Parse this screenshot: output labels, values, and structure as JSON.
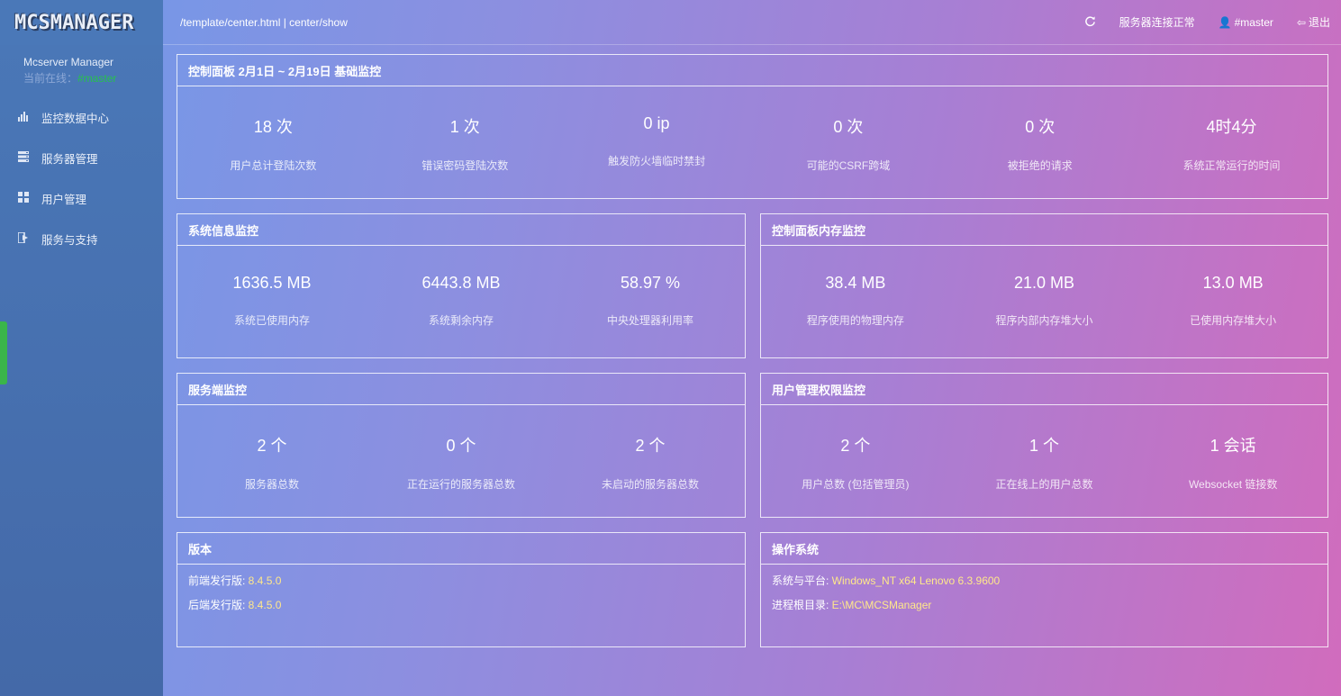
{
  "sidebar": {
    "logo": "MCSMANAGER",
    "app_name": "Mcserver Manager",
    "online_prefix": "当前在线：",
    "online_user": "#master",
    "items": [
      {
        "icon": "bar-chart-icon",
        "label": "监控数据中心"
      },
      {
        "icon": "server-icon",
        "label": "服务器管理"
      },
      {
        "icon": "grid-icon",
        "label": "用户管理"
      },
      {
        "icon": "support-icon",
        "label": "服务与支持"
      }
    ]
  },
  "topbar": {
    "path": "/template/center.html | center/show",
    "refresh_icon": "refresh-icon",
    "status": "服务器连接正常",
    "user": "#master",
    "logout": "退出"
  },
  "panels": {
    "overview": {
      "title": "控制面板 2月1日 ~ 2月19日 基础监控",
      "stats": [
        {
          "value": "18 次",
          "label": "用户总计登陆次数"
        },
        {
          "value": "1 次",
          "label": "错误密码登陆次数"
        },
        {
          "value": "0 ip",
          "label": "触发防火墙临时禁封"
        },
        {
          "value": "0 次",
          "label": "可能的CSRF跨域"
        },
        {
          "value": "0 次",
          "label": "被拒绝的请求"
        },
        {
          "value": "4时4分",
          "label": "系统正常运行的时间"
        }
      ]
    },
    "system": {
      "title": "系统信息监控",
      "stats": [
        {
          "value": "1636.5 MB",
          "label": "系统已使用内存"
        },
        {
          "value": "6443.8 MB",
          "label": "系统剩余内存"
        },
        {
          "value": "58.97 %",
          "label": "中央处理器利用率"
        }
      ]
    },
    "memory": {
      "title": "控制面板内存监控",
      "stats": [
        {
          "value": "38.4 MB",
          "label": "程序使用的物理内存"
        },
        {
          "value": "21.0 MB",
          "label": "程序内部内存堆大小"
        },
        {
          "value": "13.0 MB",
          "label": "已使用内存堆大小"
        }
      ]
    },
    "servers": {
      "title": "服务端监控",
      "stats": [
        {
          "value": "2 个",
          "label": "服务器总数"
        },
        {
          "value": "0 个",
          "label": "正在运行的服务器总数"
        },
        {
          "value": "2 个",
          "label": "未启动的服务器总数"
        }
      ]
    },
    "users": {
      "title": "用户管理权限监控",
      "stats": [
        {
          "value": "2 个",
          "label": "用户总数 (包括管理员)"
        },
        {
          "value": "1 个",
          "label": "正在线上的用户总数"
        },
        {
          "value": "1 会话",
          "label": "Websocket 链接数"
        }
      ]
    },
    "version": {
      "title": "版本",
      "rows": [
        {
          "key": "前端发行版: ",
          "value": "8.4.5.0"
        },
        {
          "key": "后端发行版: ",
          "value": "8.4.5.0"
        }
      ]
    },
    "os": {
      "title": "操作系统",
      "rows": [
        {
          "key": "系统与平台: ",
          "value": "Windows_NT x64 Lenovo 6.3.9600"
        },
        {
          "key": "进程根目录: ",
          "value": "E:\\MC\\MCSManager"
        }
      ]
    }
  }
}
